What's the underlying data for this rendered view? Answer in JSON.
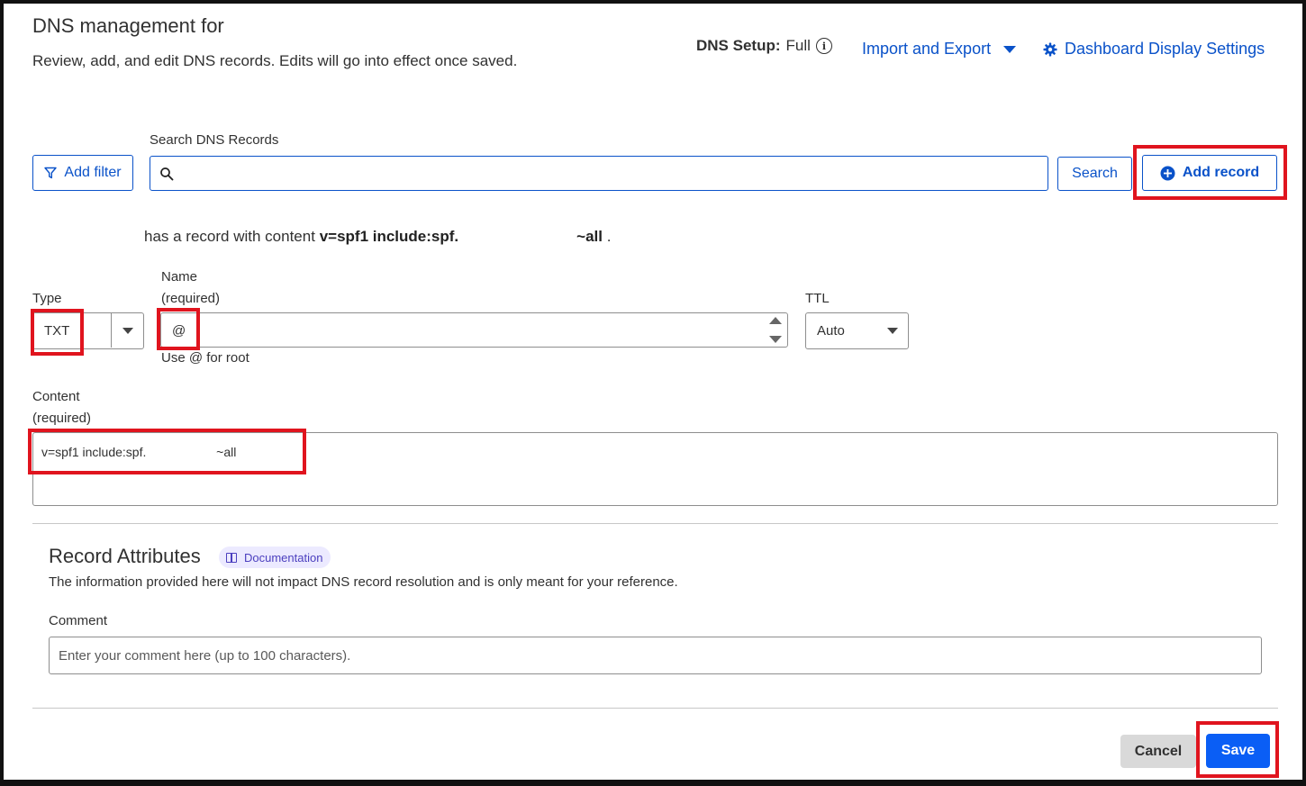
{
  "header": {
    "title": "DNS management for",
    "subtitle": "Review, add, and edit DNS records. Edits will go into effect once saved.",
    "dns_setup_label": "DNS Setup:",
    "dns_setup_value": "Full",
    "import_export": "Import and Export",
    "dashboard_settings": "Dashboard Display Settings"
  },
  "search": {
    "label": "Search DNS Records",
    "placeholder": "",
    "add_filter": "Add filter",
    "search_button": "Search",
    "add_record": "Add record"
  },
  "record_summary": {
    "prefix": "has a record with content",
    "content_start": "v=spf1 include:spf.",
    "content_end": "~all",
    "suffix": "."
  },
  "form": {
    "type_label": "Type",
    "type_value": "TXT",
    "name_label": "Name",
    "name_required": "(required)",
    "name_value": "@",
    "name_hint": "Use @ for root",
    "ttl_label": "TTL",
    "ttl_value": "Auto",
    "content_label": "Content",
    "content_required": "(required)",
    "content_value": "v=spf1 include:spf.                    ~all"
  },
  "attributes": {
    "title": "Record Attributes",
    "doc_badge": "Documentation",
    "description": "The information provided here will not impact DNS record resolution and is only meant for your reference.",
    "comment_label": "Comment",
    "comment_placeholder": "Enter your comment here (up to 100 characters)."
  },
  "footer": {
    "cancel": "Cancel",
    "save": "Save"
  },
  "colors": {
    "link": "#0a52c9",
    "save_button": "#0a5ef5",
    "highlight": "#e0141e"
  },
  "icons": [
    "info-icon",
    "caret-down-icon",
    "gear-icon",
    "filter-icon",
    "search-icon",
    "plus-circle-icon",
    "book-icon"
  ]
}
